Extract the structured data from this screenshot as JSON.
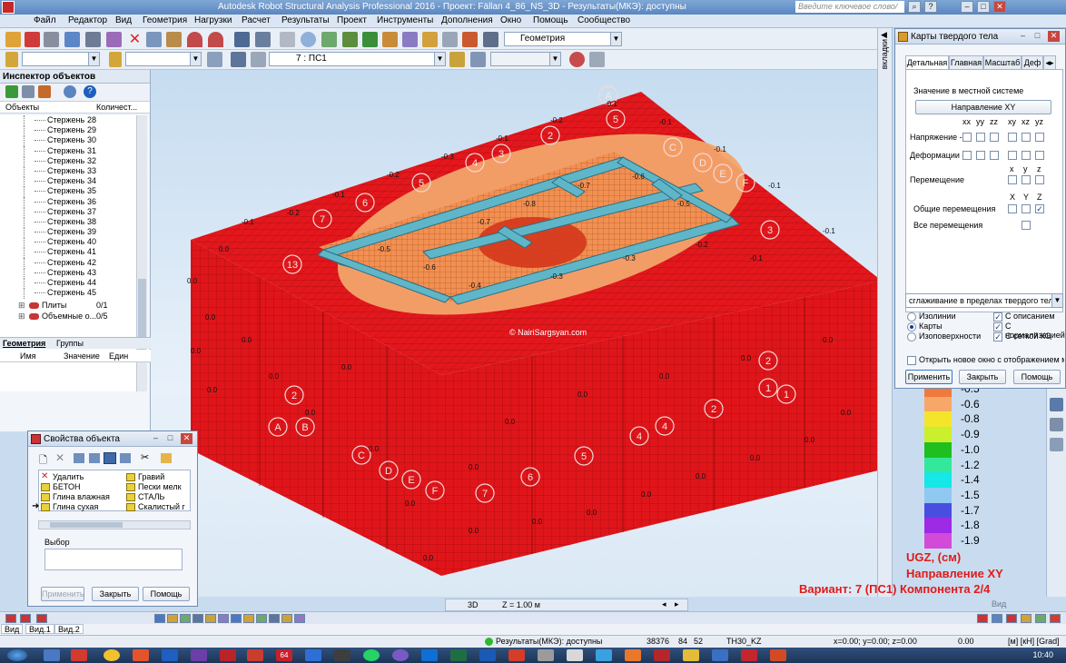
{
  "app": {
    "title": "Autodesk Robot Structural Analysis Professional 2016 - Проект: Fällan 4_86_NS_3D - Результаты(МКЭ): доступны",
    "search_placeholder": "Введите ключевое слово/фразу"
  },
  "menu": [
    "Файл",
    "Редактор",
    "Вид",
    "Геометрия",
    "Нагрузки",
    "Расчет",
    "Результаты",
    "Проект",
    "Инструменты",
    "Дополнения",
    "Окно",
    "Помощь",
    "Сообщество"
  ],
  "toolbar": {
    "geometry_combo": "Геометрия",
    "case_combo": "7 : ПС1"
  },
  "inspector": {
    "title": "Инспектор объектов",
    "col_objects": "Объекты",
    "col_count": "Количест...",
    "rows": [
      {
        "label": "Стержень",
        "count": "28"
      },
      {
        "label": "Стержень",
        "count": "29"
      },
      {
        "label": "Стержень",
        "count": "30"
      },
      {
        "label": "Стержень",
        "count": "31"
      },
      {
        "label": "Стержень",
        "count": "32"
      },
      {
        "label": "Стержень",
        "count": "33"
      },
      {
        "label": "Стержень",
        "count": "34"
      },
      {
        "label": "Стержень",
        "count": "35"
      },
      {
        "label": "Стержень",
        "count": "36"
      },
      {
        "label": "Стержень",
        "count": "37"
      },
      {
        "label": "Стержень",
        "count": "38"
      },
      {
        "label": "Стержень",
        "count": "39"
      },
      {
        "label": "Стержень",
        "count": "40"
      },
      {
        "label": "Стержень",
        "count": "41"
      },
      {
        "label": "Стержень",
        "count": "42"
      },
      {
        "label": "Стержень",
        "count": "43"
      },
      {
        "label": "Стержень",
        "count": "44"
      },
      {
        "label": "Стержень",
        "count": "45"
      }
    ],
    "group_plates": {
      "label": "Плиты",
      "count": "0/1"
    },
    "group_volumes": {
      "label": "Объемные о...",
      "count": "0/5"
    },
    "tab_geometry": "Геометрия",
    "tab_groups": "Группы",
    "prop_cols": [
      "Имя",
      "Значение",
      "Един"
    ]
  },
  "model": {
    "watermark": "© NairiSargsyan.com",
    "axis_labels": [
      "A",
      "B",
      "C",
      "D",
      "E",
      "F",
      "1",
      "2",
      "3",
      "4",
      "5",
      "6",
      "7",
      "13"
    ],
    "values_top": [
      "-0.1",
      "-0.2",
      "-0.3",
      "-0.4",
      "-0.5",
      "-0.6",
      "-0.7",
      "-0.8"
    ],
    "value_side": "0.0"
  },
  "legend": {
    "items": [
      {
        "value": "-0.5",
        "color": "#f07a3c"
      },
      {
        "value": "-0.6",
        "color": "#f7a868"
      },
      {
        "value": "-0.8",
        "color": "#f5e52a"
      },
      {
        "value": "-0.9",
        "color": "#c9ef2d"
      },
      {
        "value": "-1.0",
        "color": "#1fbf1f"
      },
      {
        "value": "-1.2",
        "color": "#33e89a"
      },
      {
        "value": "-1.4",
        "color": "#16e7e7"
      },
      {
        "value": "-1.5",
        "color": "#8fc9f2"
      },
      {
        "value": "-1.7",
        "color": "#4a4ee0"
      },
      {
        "value": "-1.8",
        "color": "#9c2ae6"
      },
      {
        "value": "-1.9",
        "color": "#d34ad8"
      }
    ],
    "quantity": "UGZ, (см)",
    "direction": "Направление XY",
    "variant": "Вариант: 7 (ПС1) Компонента 2/4"
  },
  "solid_maps": {
    "title": "Карты твердого тела",
    "vtab_label": "вкладки",
    "tabs": [
      "Детальная",
      "Главная",
      "Масштаб",
      "Деф"
    ],
    "local_system_label": "Значение в местной системе",
    "direction_button": "Направление XY",
    "stress_cols": [
      "xx",
      "yy",
      "zz",
      "xy",
      "xz",
      "yz"
    ],
    "row_stress": "Напряжение - s",
    "row_strain": "Деформации - e",
    "row_displacement": "Перемещение",
    "disp_cols": [
      "x",
      "y",
      "z"
    ],
    "general_cols": [
      "X",
      "Y",
      "Z"
    ],
    "row_general": "Общие перемещения",
    "row_all": "Все перемещения",
    "smoothing": "сглаживание в пределах твердого тела",
    "radio_isolines": "Изолинии",
    "radio_maps": "Карты",
    "radio_isosurfaces": "Изоповерхности",
    "cb_description": "С описанием",
    "cb_normalization": "С нормализацией",
    "cb_mesh": "С сеткой КЭ",
    "cb_new_window": "Открыть новое окно с отображением масштаб",
    "btn_apply": "Применить",
    "btn_close": "Закрыть",
    "btn_help": "Помощь"
  },
  "object_props": {
    "title": "Свойства объекта",
    "materials_left": [
      "Удалить",
      "БЕТОН",
      "Глина влажная",
      "Глина сухая"
    ],
    "materials_right": [
      "Гравий",
      "Пески мелк",
      "СТАЛЬ",
      "Скалистый г"
    ],
    "selection_label": "Выбор",
    "btn_apply": "Применить",
    "btn_close": "Закрыть",
    "btn_help": "Помощь"
  },
  "viewbar": {
    "mode": "3D",
    "z": "Z = 1.00 м"
  },
  "view_tabs": [
    "Вид",
    "Вид.1",
    "Вид.2"
  ],
  "view_label": "Вид",
  "status": {
    "results": "Результаты(МКЭ): доступны",
    "nodes": "38376",
    "n1": "84",
    "n2": "52",
    "section": "ТН30_KZ",
    "coords": "x=0.00; y=0.00; z=0.00",
    "angle": "0.00",
    "units": "[м] [кН] [Grad]"
  },
  "taskbar": {
    "time": "10:40",
    "badge": "64"
  }
}
